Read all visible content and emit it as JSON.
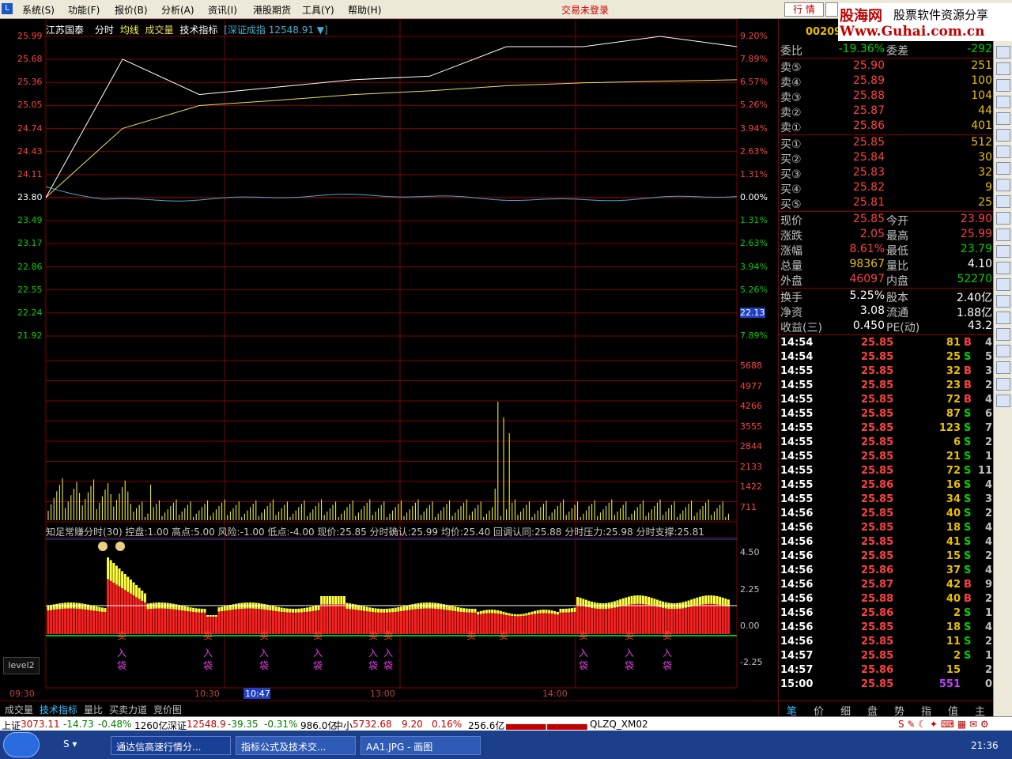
{
  "menubar": {
    "items": [
      "系统(S)",
      "功能(F)",
      "报价(B)",
      "分析(A)",
      "资讯(I)",
      "港股期货",
      "工具(Y)",
      "帮助(H)"
    ],
    "login_status": "交易未登录",
    "quote_button": "行 情"
  },
  "watermark": {
    "line1": "股海网",
    "line1b": "股票软件资源分享",
    "line2": "Www.Guhai.com.cn"
  },
  "chart": {
    "stock_name": "江苏国泰",
    "tabs": [
      "分时",
      "均线",
      "成交量",
      "技术指标"
    ],
    "index_label": "[深证成指 12548.91 ▼]",
    "price_axis_left": [
      "25.99",
      "25.68",
      "25.36",
      "25.05",
      "24.74",
      "24.43",
      "24.11",
      "23.80",
      "23.49",
      "23.17",
      "22.86",
      "22.55",
      "22.24",
      "21.92"
    ],
    "pct_axis_right": [
      "9.20%",
      "7.89%",
      "6.57%",
      "5.26%",
      "3.94%",
      "2.63%",
      "1.31%",
      "0.00%",
      "1.31%",
      "2.63%",
      "3.94%",
      "5.26%",
      "22.13",
      "7.89%"
    ],
    "volume_axis": [
      "5688",
      "4977",
      "4266",
      "3555",
      "2844",
      "2133",
      "1422",
      "711"
    ],
    "indicator_axis": [
      "4.50",
      "2.25",
      "0.00",
      "-2.25"
    ],
    "indicator_title": "知足常赚分时(30)  控盘:1.00  高点:5.00  风险:-1.00  低点:-4.00  现价:25.85  分时确认:25.99  均价:25.40  回调认同:25.88  分时压力:25.98  分时支撑:25.81",
    "time_labels": [
      "09:30",
      "10:30",
      "10:47",
      "13:00",
      "14:00"
    ],
    "signal_sell": "卖",
    "signal_in": "入",
    "signal_bag": "袋",
    "level2_label": "level2",
    "colors": {
      "price": "#ffffff",
      "avg": "#e8e060",
      "index": "#40b0d0",
      "grid": "#800000",
      "up": "#ff2020",
      "yellow": "#ffff40",
      "green": "#00c000",
      "purple": "#e040e0"
    }
  },
  "chart_data": {
    "type": "line",
    "title": "江苏国泰",
    "x": [
      "09:30",
      "10:30",
      "11:30/13:00",
      "14:00",
      "15:00"
    ],
    "ylim": [
      21.92,
      25.99
    ],
    "prev_close": 23.8,
    "series": [
      {
        "name": "现价",
        "values": [
          23.8,
          25.68,
          25.2,
          25.3,
          25.4,
          25.45,
          25.85,
          25.85,
          25.99,
          25.85
        ]
      },
      {
        "name": "均价",
        "values": [
          23.8,
          24.74,
          25.05,
          25.12,
          25.2,
          25.25,
          25.32,
          25.36,
          25.38,
          25.4
        ]
      }
    ]
  },
  "right_panel": {
    "stock_code": "002091",
    "wb_label": "委比",
    "wb_value": "-19.36%",
    "wc_label": "委差",
    "wc_value": "-292",
    "asks": [
      {
        "label": "卖⑤",
        "price": "25.90",
        "vol": "251"
      },
      {
        "label": "卖④",
        "price": "25.89",
        "vol": "100"
      },
      {
        "label": "卖③",
        "price": "25.88",
        "vol": "104"
      },
      {
        "label": "卖②",
        "price": "25.87",
        "vol": "44"
      },
      {
        "label": "卖①",
        "price": "25.86",
        "vol": "401"
      }
    ],
    "bids": [
      {
        "label": "买①",
        "price": "25.85",
        "vol": "512"
      },
      {
        "label": "买②",
        "price": "25.84",
        "vol": "30"
      },
      {
        "label": "买③",
        "price": "25.83",
        "vol": "32"
      },
      {
        "label": "买④",
        "price": "25.82",
        "vol": "9"
      },
      {
        "label": "买⑤",
        "price": "25.81",
        "vol": "25"
      }
    ],
    "stats": [
      {
        "k1": "现价",
        "v1": "25.85",
        "k2": "今开",
        "v2": "23.90",
        "c1": "#ff4040",
        "c2": "#ff4040"
      },
      {
        "k1": "涨跌",
        "v1": "2.05",
        "k2": "最高",
        "v2": "25.99",
        "c1": "#ff4040",
        "c2": "#ff4040"
      },
      {
        "k1": "涨幅",
        "v1": "8.61%",
        "k2": "最低",
        "v2": "23.79",
        "c1": "#ff4040",
        "c2": "#00d000"
      },
      {
        "k1": "总量",
        "v1": "98367",
        "k2": "量比",
        "v2": "4.10",
        "c1": "#e8c000",
        "c2": "#ffffff"
      },
      {
        "k1": "外盘",
        "v1": "46097",
        "k2": "内盘",
        "v2": "52270",
        "c1": "#ff4040",
        "c2": "#00d000"
      }
    ],
    "stats2": [
      {
        "k1": "换手",
        "v1": "5.25%",
        "k2": "股本",
        "v2": "2.40亿"
      },
      {
        "k1": "净资",
        "v1": "3.08",
        "k2": "流通",
        "v2": "1.88亿"
      },
      {
        "k1": "收益(三)",
        "v1": "0.450",
        "k2": "PE(动)",
        "v2": "43.2"
      }
    ],
    "trades": [
      {
        "t": "14:54",
        "p": "25.85",
        "v": "81",
        "s": "B",
        "n": "4"
      },
      {
        "t": "14:54",
        "p": "25.85",
        "v": "25",
        "s": "S",
        "n": "5"
      },
      {
        "t": "14:55",
        "p": "25.85",
        "v": "32",
        "s": "B",
        "n": "3"
      },
      {
        "t": "14:55",
        "p": "25.85",
        "v": "23",
        "s": "B",
        "n": "2"
      },
      {
        "t": "14:55",
        "p": "25.85",
        "v": "72",
        "s": "B",
        "n": "4"
      },
      {
        "t": "14:55",
        "p": "25.85",
        "v": "87",
        "s": "S",
        "n": "6"
      },
      {
        "t": "14:55",
        "p": "25.85",
        "v": "123",
        "s": "S",
        "n": "7"
      },
      {
        "t": "14:55",
        "p": "25.85",
        "v": "6",
        "s": "S",
        "n": "2"
      },
      {
        "t": "14:55",
        "p": "25.85",
        "v": "21",
        "s": "S",
        "n": "1"
      },
      {
        "t": "14:55",
        "p": "25.85",
        "v": "72",
        "s": "S",
        "n": "11"
      },
      {
        "t": "14:55",
        "p": "25.86",
        "v": "16",
        "s": "S",
        "n": "4"
      },
      {
        "t": "14:55",
        "p": "25.85",
        "v": "34",
        "s": "S",
        "n": "3"
      },
      {
        "t": "14:56",
        "p": "25.85",
        "v": "40",
        "s": "S",
        "n": "2"
      },
      {
        "t": "14:56",
        "p": "25.85",
        "v": "18",
        "s": "S",
        "n": "4"
      },
      {
        "t": "14:56",
        "p": "25.85",
        "v": "41",
        "s": "S",
        "n": "4"
      },
      {
        "t": "14:56",
        "p": "25.85",
        "v": "15",
        "s": "S",
        "n": "2"
      },
      {
        "t": "14:56",
        "p": "25.86",
        "v": "37",
        "s": "S",
        "n": "4"
      },
      {
        "t": "14:56",
        "p": "25.87",
        "v": "42",
        "s": "B",
        "n": "9"
      },
      {
        "t": "14:56",
        "p": "25.88",
        "v": "40",
        "s": "B",
        "n": "2"
      },
      {
        "t": "14:56",
        "p": "25.86",
        "v": "2",
        "s": "S",
        "n": "1"
      },
      {
        "t": "14:56",
        "p": "25.85",
        "v": "18",
        "s": "S",
        "n": "4"
      },
      {
        "t": "14:56",
        "p": "25.85",
        "v": "11",
        "s": "S",
        "n": "2"
      },
      {
        "t": "14:57",
        "p": "25.85",
        "v": "2",
        "s": "S",
        "n": "1"
      },
      {
        "t": "14:57",
        "p": "25.86",
        "v": "15",
        "s": "",
        "n": "2"
      },
      {
        "t": "15:00",
        "p": "25.85",
        "v": "551",
        "s": "",
        "n": "0"
      }
    ],
    "tabs": [
      "笔",
      "价",
      "细",
      "盘",
      "势",
      "指",
      "值",
      "主"
    ]
  },
  "bottom_tabs": [
    "成交量",
    "技术指标",
    "量比",
    "买卖力道",
    "竞价图"
  ],
  "status_bar": {
    "sh_label": "上证",
    "sh_value": "3073.11",
    "sh_change": "-14.73",
    "sh_pct": "-0.48%",
    "sh_amount": "1260亿",
    "sz_label": "深证",
    "sz_value": "12548.9",
    "sz_change": "-39.35",
    "sz_pct": "-0.31%",
    "sz_amount": "986.0亿",
    "zx_label": "中小",
    "zx_value": "5732.68",
    "zx_change": "9.20",
    "zx_pct": "0.16%",
    "zx_amount": "256.6亿",
    "ticker_code": "QLZQ_XM02"
  },
  "taskbar": {
    "tasks": [
      "通达信高速行情分...",
      "指标公式及技术交...",
      "AA1.JPG - 画图"
    ],
    "clock": "21:36"
  }
}
